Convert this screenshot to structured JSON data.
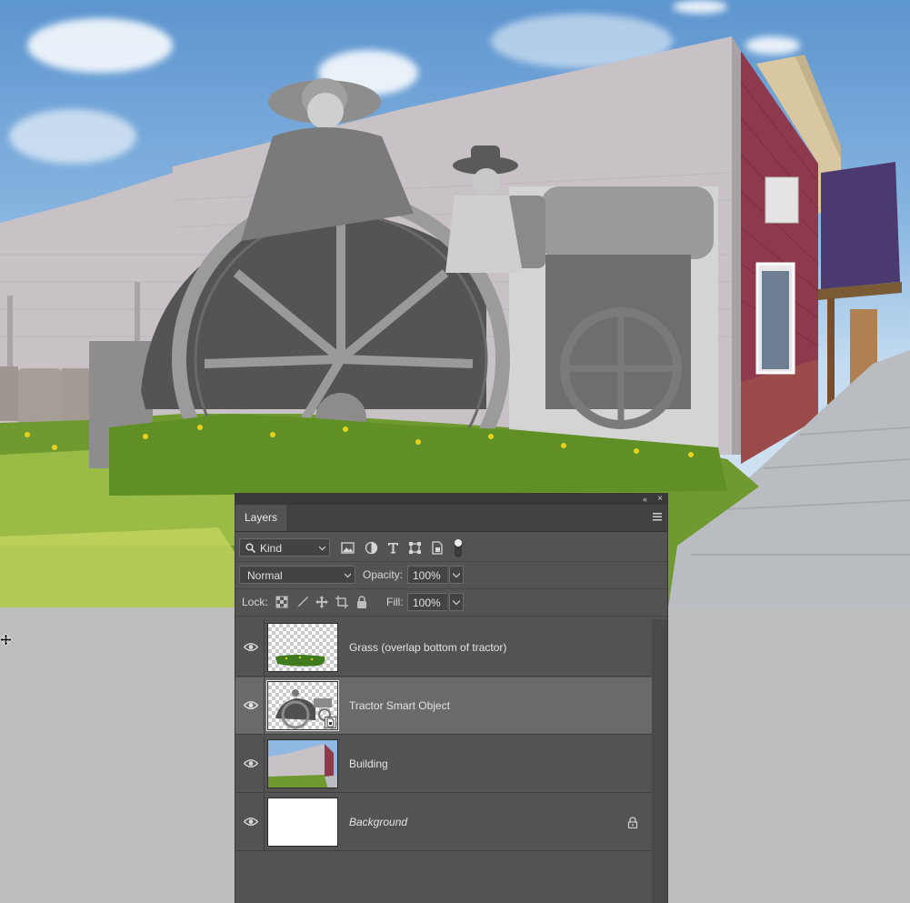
{
  "canvas": {
    "description_name": "composite-canvas",
    "colors": {
      "sky": "#7fb0de",
      "wall": "#c9c3c6",
      "grass": "#6a9a2a",
      "dandelion": "#e8d21e"
    }
  },
  "cursor": {
    "icon": "move-cursor-icon"
  },
  "panel": {
    "tab_label": "Layers",
    "collapse_glyph": "«",
    "close_glyph": "×",
    "menu_icon": "panel-menu-icon",
    "filter": {
      "kind_label": "Kind",
      "icons": [
        "pixel-filter-icon",
        "adjustment-filter-icon",
        "type-filter-icon",
        "shape-filter-icon",
        "smart-object-filter-icon",
        "filter-toggle-icon"
      ]
    },
    "blend_mode": "Normal",
    "opacity_label": "Opacity:",
    "opacity_value": "100%",
    "lock_label": "Lock:",
    "lock_icons": [
      "lock-transparency-icon",
      "lock-image-icon",
      "lock-position-icon",
      "lock-artboard-icon",
      "lock-all-icon"
    ],
    "fill_label": "Fill:",
    "fill_value": "100%",
    "layers": [
      {
        "name": "Grass (overlap bottom of tractor)",
        "visible": true,
        "selected": false,
        "locked": false,
        "italic": false
      },
      {
        "name": "Tractor Smart Object",
        "visible": true,
        "selected": true,
        "locked": false,
        "italic": false,
        "smart_object": true
      },
      {
        "name": "Building",
        "visible": true,
        "selected": false,
        "locked": false,
        "italic": false
      },
      {
        "name": "Background",
        "visible": true,
        "selected": false,
        "locked": true,
        "italic": true
      }
    ]
  }
}
